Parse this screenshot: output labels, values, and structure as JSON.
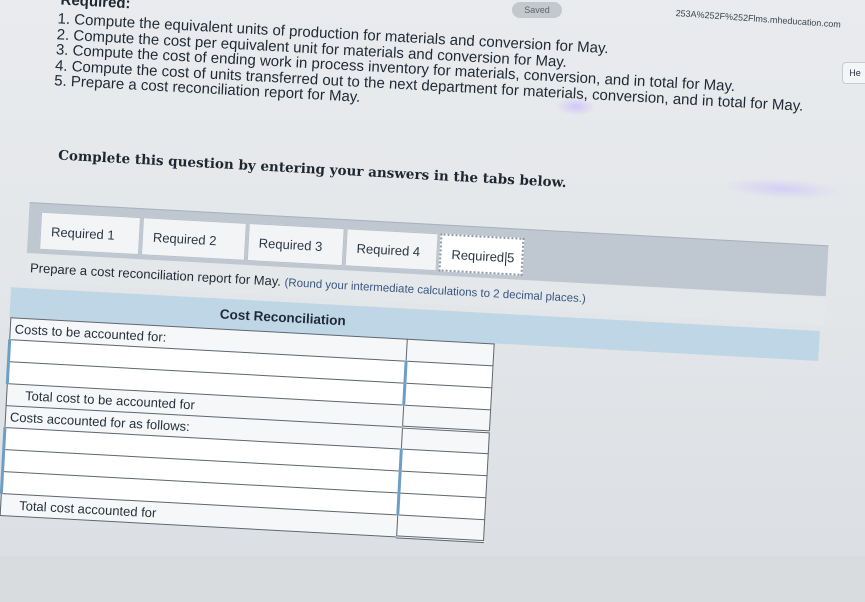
{
  "topbar": {
    "saved_label": "Saved",
    "url_text": "253A%252F%252Flms.mheducation.com",
    "right_pill": "He"
  },
  "assignment": {
    "required_heading": "Required:",
    "requirements": [
      "1. Compute the equivalent units of production for materials and conversion for May.",
      "2. Compute the cost per equivalent unit for materials and conversion for May.",
      "3. Compute the cost of ending work in process inventory for materials, conversion, and in total for May.",
      "4. Compute the cost of units transferred out to the next department for materials, conversion, and in total for May.",
      "5. Prepare a cost reconciliation report for May."
    ],
    "complete_text": "Complete this question by entering your answers in the tabs below."
  },
  "tabs": [
    {
      "label": "Required 1",
      "active": false
    },
    {
      "label": "Required 2",
      "active": false
    },
    {
      "label": "Required 3",
      "active": false
    },
    {
      "label": "Required 4",
      "active": false
    },
    {
      "label_a": "Required",
      "label_b": "5",
      "active": true
    }
  ],
  "prompt": {
    "text": "Prepare a cost reconciliation report for May.",
    "hint": "(Round your intermediate calculations to 2 decimal places.)"
  },
  "table": {
    "title": "Cost Reconciliation",
    "rows": {
      "costs_to_account": "Costs to be accounted for:",
      "total_cost_to_account": "Total cost to be accounted for",
      "costs_accounted_as_follows": "Costs accounted for as follows:",
      "total_cost_accounted": "Total cost accounted for"
    }
  }
}
